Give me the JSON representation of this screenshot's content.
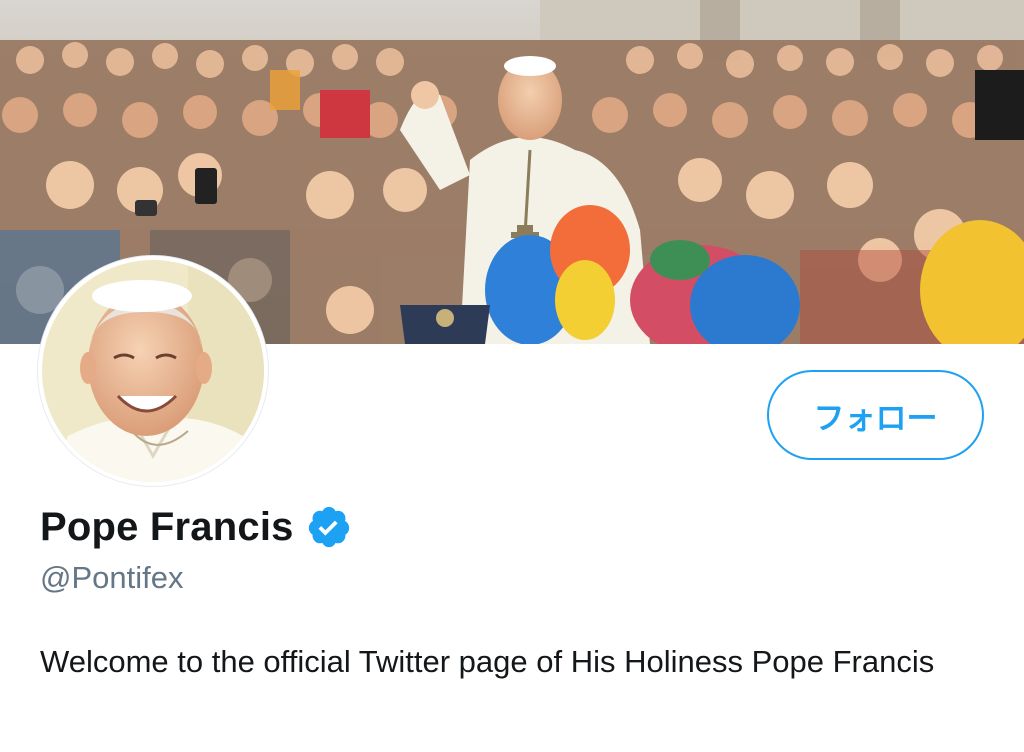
{
  "profile": {
    "display_name": "Pope Francis",
    "handle": "@Pontifex",
    "bio": "Welcome to the official Twitter page of His Holiness Pope Francis",
    "verified": true
  },
  "actions": {
    "follow_label": "フォロー"
  },
  "icons": {
    "verified": "verified-badge-icon"
  },
  "colors": {
    "accent": "#1da1f2",
    "name_text": "#14171a",
    "handle_text": "#657786"
  }
}
